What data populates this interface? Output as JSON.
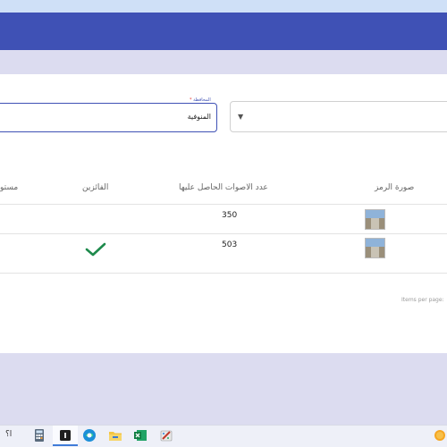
{
  "form": {
    "field_label": "المحافظة",
    "field_required_mark": "*",
    "field_value": "المنوفية"
  },
  "table": {
    "headers": {
      "image": "صورة الرمز",
      "votes": "عدد الاصوات الحاصل عليها",
      "winners": "الفائزين",
      "rank": "مستو"
    },
    "rows": [
      {
        "votes": "350",
        "winner": false
      },
      {
        "votes": "503",
        "winner": true
      }
    ]
  },
  "paginator": {
    "items_per_page": "Items per page:"
  },
  "taskbar": {
    "leading_text": "ا؟"
  },
  "colors": {
    "primary": "#3f51b5",
    "check": "#1e8a4c"
  }
}
